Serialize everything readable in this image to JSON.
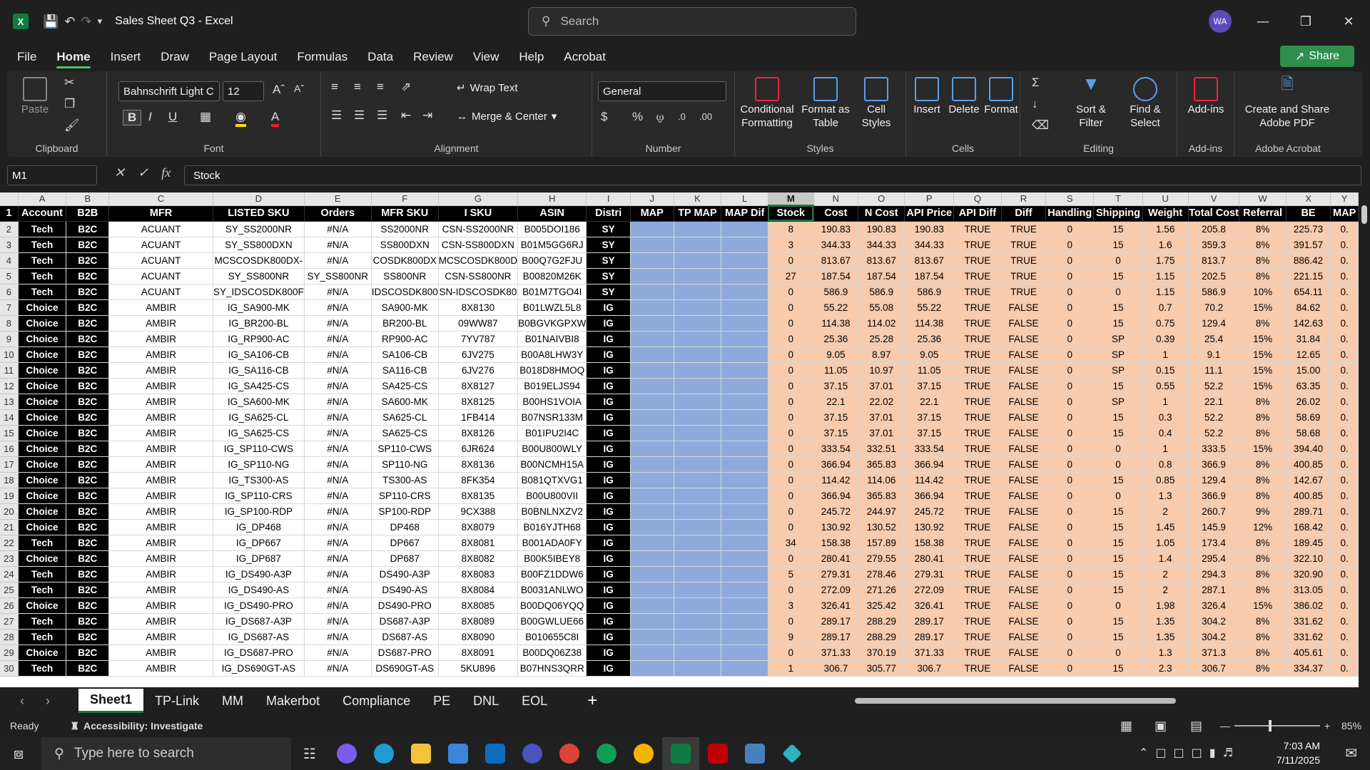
{
  "window": {
    "title": "Sales Sheet Q3 - Excel",
    "search_placeholder": "Search",
    "avatar": "WA",
    "share": "Share"
  },
  "menu": [
    "File",
    "Home",
    "Insert",
    "Draw",
    "Page Layout",
    "Formulas",
    "Data",
    "Review",
    "View",
    "Help",
    "Acrobat"
  ],
  "ribbon": {
    "clipboard": {
      "label": "Clipboard",
      "paste": "Paste"
    },
    "font": {
      "label": "Font",
      "name": "Bahnschrift Light C",
      "size": "12"
    },
    "alignment": {
      "label": "Alignment",
      "wrap": "Wrap Text",
      "merge": "Merge & Center"
    },
    "number": {
      "label": "Number",
      "format": "General"
    },
    "styles": {
      "label": "Styles",
      "conditional": "Conditional Formatting",
      "format_table": "Format as Table",
      "cell_styles": "Cell Styles"
    },
    "cells": {
      "label": "Cells",
      "insert": "Insert",
      "delete": "Delete",
      "format": "Format"
    },
    "editing": {
      "label": "Editing",
      "sort": "Sort & Filter",
      "find": "Find & Select"
    },
    "addins": {
      "label": "Add-ins",
      "addins": "Add-ins"
    },
    "acrobat": {
      "label": "Adobe Acrobat",
      "create": "Create and Share Adobe PDF"
    }
  },
  "formula_bar": {
    "name_box": "M1",
    "content": "Stock"
  },
  "columns": [
    "A",
    "B",
    "C",
    "D",
    "E",
    "F",
    "G",
    "H",
    "I",
    "J",
    "K",
    "L",
    "M",
    "N",
    "O",
    "P",
    "Q",
    "R",
    "S",
    "T",
    "U",
    "V",
    "W",
    "X",
    "Y"
  ],
  "headers": [
    "Account",
    "B2B",
    "MFR",
    "LISTED SKU",
    "Orders",
    "MFR SKU",
    "I SKU",
    "ASIN",
    "Distri",
    "MAP",
    "TP MAP",
    "MAP Dif",
    "Stock",
    "Cost",
    "N Cost",
    "API Price",
    "API Diff",
    "Diff",
    "Handling",
    "Shipping",
    "Weight",
    "Total Cost",
    "Referral",
    "BE",
    "MAP"
  ],
  "rows": [
    [
      "2",
      "Tech",
      "B2C",
      "ACUANT",
      "SY_SS2000NR",
      "#N/A",
      "SS2000NR",
      "CSN-SS2000NR",
      "B005DOI186",
      "SY",
      "",
      "",
      "",
      "8",
      "190.83",
      "190.83",
      "190.83",
      "TRUE",
      "TRUE",
      "0",
      "15",
      "1.56",
      "205.8",
      "8%",
      "225.73",
      "0."
    ],
    [
      "3",
      "Tech",
      "B2C",
      "ACUANT",
      "SY_SS800DXN",
      "#N/A",
      "SS800DXN",
      "CSN-SS800DXN",
      "B01M5GG6RJ",
      "SY",
      "",
      "",
      "",
      "3",
      "344.33",
      "344.33",
      "344.33",
      "TRUE",
      "TRUE",
      "0",
      "15",
      "1.6",
      "359.3",
      "8%",
      "391.57",
      "0."
    ],
    [
      "4",
      "Tech",
      "B2C",
      "ACUANT",
      "MCSCOSDK800DX-",
      "#N/A",
      "COSDK800DX",
      "MCSCOSDK800D",
      "B00Q7G2FJU",
      "SY",
      "",
      "",
      "",
      "0",
      "813.67",
      "813.67",
      "813.67",
      "TRUE",
      "TRUE",
      "0",
      "0",
      "1.75",
      "813.7",
      "8%",
      "886.42",
      "0."
    ],
    [
      "5",
      "Tech",
      "B2C",
      "ACUANT",
      "SY_SS800NR",
      "SY_SS800NR",
      "SS800NR",
      "CSN-SS800NR",
      "B00820M26K",
      "SY",
      "",
      "",
      "",
      "27",
      "187.54",
      "187.54",
      "187.54",
      "TRUE",
      "TRUE",
      "0",
      "15",
      "1.15",
      "202.5",
      "8%",
      "221.15",
      "0."
    ],
    [
      "6",
      "Tech",
      "B2C",
      "ACUANT",
      "SY_IDSCOSDK800F",
      "#N/A",
      "IDSCOSDK800",
      "SN-IDSCOSDK80",
      "B01M7TGO4I",
      "SY",
      "",
      "",
      "",
      "0",
      "586.9",
      "586.9",
      "586.9",
      "TRUE",
      "TRUE",
      "0",
      "0",
      "1.15",
      "586.9",
      "10%",
      "654.11",
      "0."
    ],
    [
      "7",
      "Choice",
      "B2C",
      "AMBIR",
      "IG_SA900-MK",
      "#N/A",
      "SA900-MK",
      "8X8130",
      "B01LWZL5L8",
      "IG",
      "",
      "",
      "",
      "0",
      "55.22",
      "55.08",
      "55.22",
      "TRUE",
      "FALSE",
      "0",
      "15",
      "0.7",
      "70.2",
      "15%",
      "84.62",
      "0."
    ],
    [
      "8",
      "Choice",
      "B2C",
      "AMBIR",
      "IG_BR200-BL",
      "#N/A",
      "BR200-BL",
      "09WW87",
      "B0BGVKGPXW",
      "IG",
      "",
      "",
      "",
      "0",
      "114.38",
      "114.02",
      "114.38",
      "TRUE",
      "FALSE",
      "0",
      "15",
      "0.75",
      "129.4",
      "8%",
      "142.63",
      "0."
    ],
    [
      "9",
      "Choice",
      "B2C",
      "AMBIR",
      "IG_RP900-AC",
      "#N/A",
      "RP900-AC",
      "7YV787",
      "B01NAIVBI8",
      "IG",
      "",
      "",
      "",
      "0",
      "25.36",
      "25.28",
      "25.36",
      "TRUE",
      "FALSE",
      "0",
      "SP",
      "0.39",
      "25.4",
      "15%",
      "31.84",
      "0."
    ],
    [
      "10",
      "Choice",
      "B2C",
      "AMBIR",
      "IG_SA106-CB",
      "#N/A",
      "SA106-CB",
      "6JV275",
      "B00A8LHW3Y",
      "IG",
      "",
      "",
      "",
      "0",
      "9.05",
      "8.97",
      "9.05",
      "TRUE",
      "FALSE",
      "0",
      "SP",
      "1",
      "9.1",
      "15%",
      "12.65",
      "0."
    ],
    [
      "11",
      "Choice",
      "B2C",
      "AMBIR",
      "IG_SA116-CB",
      "#N/A",
      "SA116-CB",
      "6JV276",
      "B018D8HMOQ",
      "IG",
      "",
      "",
      "",
      "0",
      "11.05",
      "10.97",
      "11.05",
      "TRUE",
      "FALSE",
      "0",
      "SP",
      "0.15",
      "11.1",
      "15%",
      "15.00",
      "0."
    ],
    [
      "12",
      "Choice",
      "B2C",
      "AMBIR",
      "IG_SA425-CS",
      "#N/A",
      "SA425-CS",
      "8X8127",
      "B019ELJS94",
      "IG",
      "",
      "",
      "",
      "0",
      "37.15",
      "37.01",
      "37.15",
      "TRUE",
      "FALSE",
      "0",
      "15",
      "0.55",
      "52.2",
      "15%",
      "63.35",
      "0."
    ],
    [
      "13",
      "Choice",
      "B2C",
      "AMBIR",
      "IG_SA600-MK",
      "#N/A",
      "SA600-MK",
      "8X8125",
      "B00HS1VOIA",
      "IG",
      "",
      "",
      "",
      "0",
      "22.1",
      "22.02",
      "22.1",
      "TRUE",
      "FALSE",
      "0",
      "SP",
      "1",
      "22.1",
      "8%",
      "26.02",
      "0."
    ],
    [
      "14",
      "Choice",
      "B2C",
      "AMBIR",
      "IG_SA625-CL",
      "#N/A",
      "SA625-CL",
      "1FB414",
      "B07NSR133M",
      "IG",
      "",
      "",
      "",
      "0",
      "37.15",
      "37.01",
      "37.15",
      "TRUE",
      "FALSE",
      "0",
      "15",
      "0.3",
      "52.2",
      "8%",
      "58.69",
      "0."
    ],
    [
      "15",
      "Choice",
      "B2C",
      "AMBIR",
      "IG_SA625-CS",
      "#N/A",
      "SA625-CS",
      "8X8126",
      "B01IPU2I4C",
      "IG",
      "",
      "",
      "",
      "0",
      "37.15",
      "37.01",
      "37.15",
      "TRUE",
      "FALSE",
      "0",
      "15",
      "0.4",
      "52.2",
      "8%",
      "58.68",
      "0."
    ],
    [
      "16",
      "Choice",
      "B2C",
      "AMBIR",
      "IG_SP110-CWS",
      "#N/A",
      "SP110-CWS",
      "6JR624",
      "B00U800WLY",
      "IG",
      "",
      "",
      "",
      "0",
      "333.54",
      "332.51",
      "333.54",
      "TRUE",
      "FALSE",
      "0",
      "0",
      "1",
      "333.5",
      "15%",
      "394.40",
      "0."
    ],
    [
      "17",
      "Choice",
      "B2C",
      "AMBIR",
      "IG_SP110-NG",
      "#N/A",
      "SP110-NG",
      "8X8136",
      "B00NCMH15A",
      "IG",
      "",
      "",
      "",
      "0",
      "366.94",
      "365.83",
      "366.94",
      "TRUE",
      "FALSE",
      "0",
      "0",
      "0.8",
      "366.9",
      "8%",
      "400.85",
      "0."
    ],
    [
      "18",
      "Choice",
      "B2C",
      "AMBIR",
      "IG_TS300-AS",
      "#N/A",
      "TS300-AS",
      "8FK354",
      "B081QTXVG1",
      "IG",
      "",
      "",
      "",
      "0",
      "114.42",
      "114.06",
      "114.42",
      "TRUE",
      "FALSE",
      "0",
      "15",
      "0.85",
      "129.4",
      "8%",
      "142.67",
      "0."
    ],
    [
      "19",
      "Choice",
      "B2C",
      "AMBIR",
      "IG_SP110-CRS",
      "#N/A",
      "SP110-CRS",
      "8X8135",
      "B00U800VII",
      "IG",
      "",
      "",
      "",
      "0",
      "366.94",
      "365.83",
      "366.94",
      "TRUE",
      "FALSE",
      "0",
      "0",
      "1.3",
      "366.9",
      "8%",
      "400.85",
      "0."
    ],
    [
      "20",
      "Choice",
      "B2C",
      "AMBIR",
      "IG_SP100-RDP",
      "#N/A",
      "SP100-RDP",
      "9CX388",
      "B0BNLNXZV2",
      "IG",
      "",
      "",
      "",
      "0",
      "245.72",
      "244.97",
      "245.72",
      "TRUE",
      "FALSE",
      "0",
      "15",
      "2",
      "260.7",
      "9%",
      "289.71",
      "0."
    ],
    [
      "21",
      "Choice",
      "B2C",
      "AMBIR",
      "IG_DP468",
      "#N/A",
      "DP468",
      "8X8079",
      "B016YJTH68",
      "IG",
      "",
      "",
      "",
      "0",
      "130.92",
      "130.52",
      "130.92",
      "TRUE",
      "FALSE",
      "0",
      "15",
      "1.45",
      "145.9",
      "12%",
      "168.42",
      "0."
    ],
    [
      "22",
      "Tech",
      "B2C",
      "AMBIR",
      "IG_DP667",
      "#N/A",
      "DP667",
      "8X8081",
      "B001ADA0FY",
      "IG",
      "",
      "",
      "",
      "34",
      "158.38",
      "157.89",
      "158.38",
      "TRUE",
      "FALSE",
      "0",
      "15",
      "1.05",
      "173.4",
      "8%",
      "189.45",
      "0."
    ],
    [
      "23",
      "Choice",
      "B2C",
      "AMBIR",
      "IG_DP687",
      "#N/A",
      "DP687",
      "8X8082",
      "B00K5IBEY8",
      "IG",
      "",
      "",
      "",
      "0",
      "280.41",
      "279.55",
      "280.41",
      "TRUE",
      "FALSE",
      "0",
      "15",
      "1.4",
      "295.4",
      "8%",
      "322.10",
      "0."
    ],
    [
      "24",
      "Tech",
      "B2C",
      "AMBIR",
      "IG_DS490-A3P",
      "#N/A",
      "DS490-A3P",
      "8X8083",
      "B00FZ1DDW6",
      "IG",
      "",
      "",
      "",
      "5",
      "279.31",
      "278.46",
      "279.31",
      "TRUE",
      "FALSE",
      "0",
      "15",
      "2",
      "294.3",
      "8%",
      "320.90",
      "0."
    ],
    [
      "25",
      "Tech",
      "B2C",
      "AMBIR",
      "IG_DS490-AS",
      "#N/A",
      "DS490-AS",
      "8X8084",
      "B0031ANLWO",
      "IG",
      "",
      "",
      "",
      "0",
      "272.09",
      "271.26",
      "272.09",
      "TRUE",
      "FALSE",
      "0",
      "15",
      "2",
      "287.1",
      "8%",
      "313.05",
      "0."
    ],
    [
      "26",
      "Choice",
      "B2C",
      "AMBIR",
      "IG_DS490-PRO",
      "#N/A",
      "DS490-PRO",
      "8X8085",
      "B00DQ06YQQ",
      "IG",
      "",
      "",
      "",
      "3",
      "326.41",
      "325.42",
      "326.41",
      "TRUE",
      "FALSE",
      "0",
      "0",
      "1.98",
      "326.4",
      "15%",
      "386.02",
      "0."
    ],
    [
      "27",
      "Tech",
      "B2C",
      "AMBIR",
      "IG_DS687-A3P",
      "#N/A",
      "DS687-A3P",
      "8X8089",
      "B00GWLUE66",
      "IG",
      "",
      "",
      "",
      "0",
      "289.17",
      "288.29",
      "289.17",
      "TRUE",
      "FALSE",
      "0",
      "15",
      "1.35",
      "304.2",
      "8%",
      "331.62",
      "0."
    ],
    [
      "28",
      "Tech",
      "B2C",
      "AMBIR",
      "IG_DS687-AS",
      "#N/A",
      "DS687-AS",
      "8X8090",
      "B010655C8I",
      "IG",
      "",
      "",
      "",
      "9",
      "289.17",
      "288.29",
      "289.17",
      "TRUE",
      "FALSE",
      "0",
      "15",
      "1.35",
      "304.2",
      "8%",
      "331.62",
      "0."
    ],
    [
      "29",
      "Choice",
      "B2C",
      "AMBIR",
      "IG_DS687-PRO",
      "#N/A",
      "DS687-PRO",
      "8X8091",
      "B00DQ06Z38",
      "IG",
      "",
      "",
      "",
      "0",
      "371.33",
      "370.19",
      "371.33",
      "TRUE",
      "FALSE",
      "0",
      "0",
      "1.3",
      "371.3",
      "8%",
      "405.61",
      "0."
    ],
    [
      "30",
      "Tech",
      "B2C",
      "AMBIR",
      "IG_DS690GT-AS",
      "#N/A",
      "DS690GT-AS",
      "5KU896",
      "B07HNS3QRR",
      "IG",
      "",
      "",
      "",
      "1",
      "306.7",
      "305.77",
      "306.7",
      "TRUE",
      "FALSE",
      "0",
      "15",
      "2.3",
      "306.7",
      "8%",
      "334.37",
      "0."
    ]
  ],
  "sheets": [
    "Sheet1",
    "TP-Link",
    "MM",
    "Makerbot",
    "Compliance",
    "PE",
    "DNL",
    "EOL"
  ],
  "status": {
    "ready": "Ready",
    "accessibility": "Accessibility: Investigate",
    "zoom": "85%"
  },
  "taskbar": {
    "search_placeholder": "Type here to search",
    "time": "7:03 AM",
    "date": "7/11/2025"
  }
}
